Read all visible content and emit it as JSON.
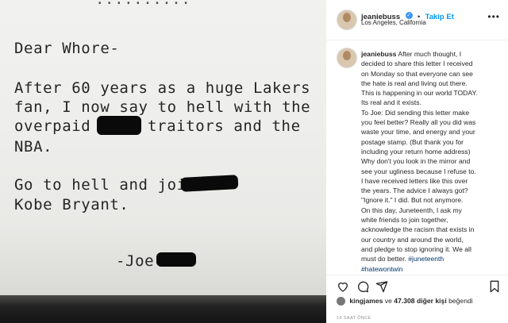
{
  "letter": {
    "greeting": "Dear Whore-",
    "para1_l1": "After 60 years as a huge Lakers",
    "para1_l2": "fan, I now say to hell with the",
    "para1_l3a": "overpaid n",
    "para1_l3b": "traitors and the",
    "para1_l4": "NBA.",
    "para2_l1": "Go to hell and join",
    "para2_l2": "Kobe Bryant.",
    "signature": "-Joe"
  },
  "header": {
    "username": "jeaniebuss",
    "follow_separator": "•",
    "follow_label": "Takip Et",
    "location": "Los Angeles, California",
    "more_label": "•••"
  },
  "caption": {
    "username": "jeaniebuss",
    "lines": [
      "After much thought, I",
      "decided to share this letter I received",
      "on Monday so that everyone can see",
      "the hate is real and living out there.",
      "This is happening in our world TODAY.",
      "Its real and it exists.",
      "To Joe: Did sending this letter make",
      "you feel better?  Really all you did was",
      "waste your time, and energy and your",
      "postage stamp. (But thank you for",
      "including your return home address)",
      "Why don't you look in the mirror and",
      "see your ugliness because I refuse to.",
      "I have received letters like this over",
      "the years. The advice I always got?",
      "\"Ignore it.\" I did. But not anymore.",
      "On this day, Juneteenth, I ask my",
      "white friends to join together,",
      "acknowledge the racism that exists in",
      "our country and around the world,",
      "and pledge to stop ignoring it. We all",
      "must do better."
    ],
    "hashtag1": "#juneteenth",
    "hashtag2": "#hatewontwin"
  },
  "likes": {
    "user": "kingjames",
    "connector": "ve",
    "count": "47.308 diğer kişi",
    "suffix": "beğendi"
  },
  "timestamp": "19 SAAT ÖNCE",
  "colors": {
    "link_blue": "#0095f6",
    "verified_blue": "#3897f0",
    "hashtag": "#00376b"
  },
  "icons": [
    "heart-icon",
    "comment-icon",
    "share-icon",
    "bookmark-icon",
    "verified-badge-icon"
  ]
}
